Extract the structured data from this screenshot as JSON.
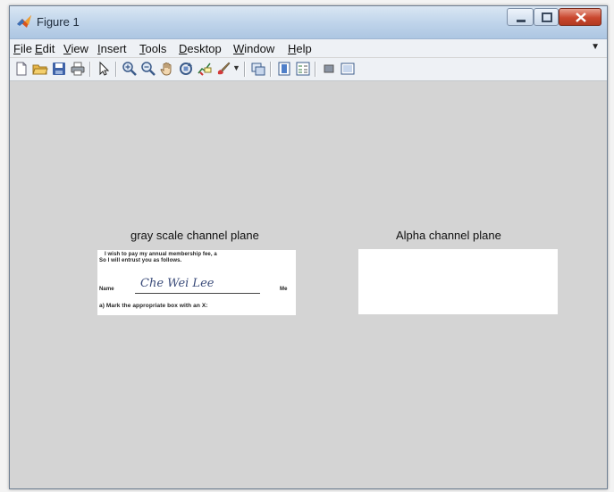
{
  "window": {
    "title": "Figure 1",
    "controls": [
      "minimize",
      "maximize",
      "close"
    ]
  },
  "menu": {
    "items": [
      "File",
      "Edit",
      "View",
      "Insert",
      "Tools",
      "Desktop",
      "Window",
      "Help"
    ]
  },
  "toolbar": {
    "buttons": [
      {
        "name": "new-figure-icon"
      },
      {
        "name": "open-file-icon"
      },
      {
        "name": "save-icon"
      },
      {
        "name": "print-icon"
      },
      {
        "name": "edit-plot-arrow-icon"
      },
      {
        "name": "zoom-in-icon"
      },
      {
        "name": "zoom-out-icon"
      },
      {
        "name": "pan-hand-icon"
      },
      {
        "name": "rotate-3d-icon"
      },
      {
        "name": "data-cursor-icon"
      },
      {
        "name": "brush-icon"
      },
      {
        "name": "link-plot-icon"
      },
      {
        "name": "insert-colorbar-icon"
      },
      {
        "name": "insert-legend-icon"
      },
      {
        "name": "hide-plot-tools-icon"
      },
      {
        "name": "show-plot-tools-icon"
      }
    ]
  },
  "subplots": [
    {
      "title": "gray scale channel plane",
      "content": {
        "line1": "I wish to pay my annual membership fee, a",
        "line2": "So I will entrust you as follows.",
        "name_label": "Name",
        "signature": "Che Wei Lee",
        "suffix": "Me",
        "line4": "a) Mark the appropriate box with an X:"
      }
    },
    {
      "title": "Alpha channel plane",
      "content": {}
    }
  ],
  "colors": {
    "figure_background": "#d4d4d4",
    "titlebar": "#bed3ea",
    "close_button": "#c9472e",
    "image_background": "#ffffff"
  }
}
